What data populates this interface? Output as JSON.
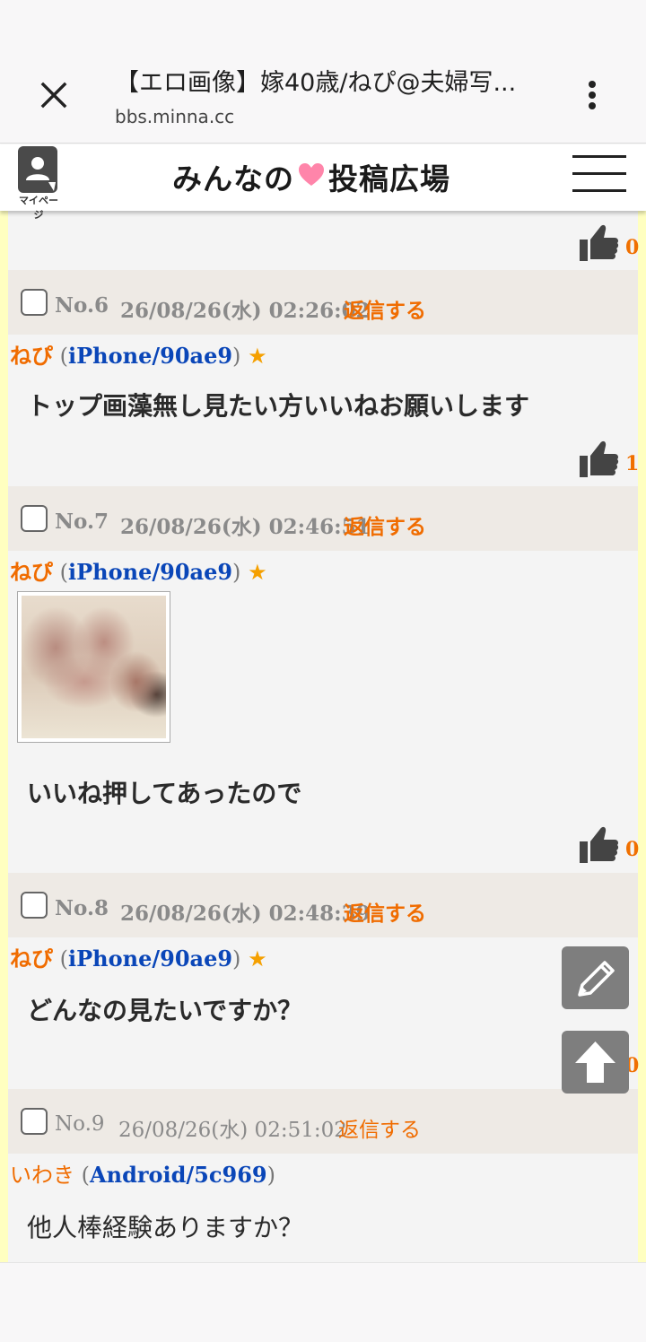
{
  "browser": {
    "page_title": "【エロ画像】嫁40歳/ねぴ@夫婦写...",
    "url": "bbs.minna.cc"
  },
  "site": {
    "mypage_label": "マイページ",
    "logo_left": "みんなの",
    "logo_right": "投稿広場",
    "heart_color": "#ff85aa"
  },
  "thread": {
    "top_likes": "0",
    "posts": [
      {
        "no": "No.6",
        "date": "26/08/26(水) 02:26:02",
        "reply": "返信する",
        "author": "ねぴ",
        "device": "iPhone/90ae9",
        "star": "★",
        "text": "トップ画藻無し見たい方いいねお願いします",
        "likes": "1"
      },
      {
        "no": "No.7",
        "date": "26/08/26(水) 02:46:51",
        "reply": "返信する",
        "author": "ねぴ",
        "device": "iPhone/90ae9",
        "star": "★",
        "text": "いいね押してあったので",
        "likes": "0"
      },
      {
        "no": "No.8",
        "date": "26/08/26(水) 02:48:39",
        "reply": "返信する",
        "author": "ねぴ",
        "device": "iPhone/90ae9",
        "star": "★",
        "text": "どんなの見たいですか？",
        "likes": "0"
      },
      {
        "no": "No.9",
        "date": "26/08/26(水) 02:51:02",
        "reply": "返信する",
        "author": "いわき",
        "device": "Android/5c969",
        "text": "他人棒経験ありますか？"
      }
    ]
  },
  "colors": {
    "accent_orange": "#f06c00",
    "device_blue": "#0a46b8",
    "star_gold": "#f5a000",
    "side_strip_yellow": "#ffffc0"
  }
}
